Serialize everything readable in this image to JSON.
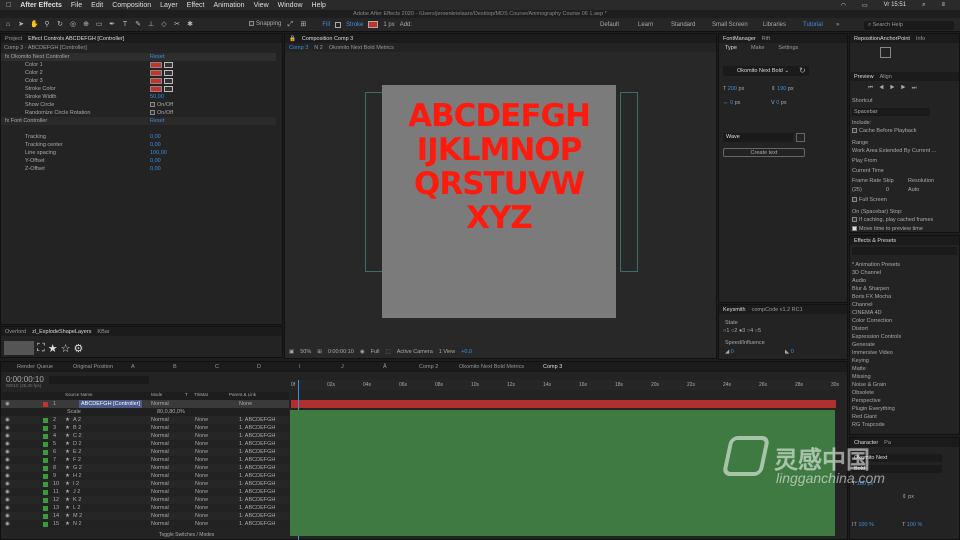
{
  "mac": {
    "apple": "",
    "app": "After Effects",
    "menus": [
      "File",
      "Edit",
      "Composition",
      "Layer",
      "Effect",
      "Animation",
      "View",
      "Window",
      "Help"
    ],
    "clock": "Vr 15:51"
  },
  "window_title": "Adobe After Effects 2020 - /Users/jeroenkrielaars/Desktop/MDS Course/Animography Course 06 1.aep *",
  "toolbar": {
    "snapping": "Snapping",
    "fill": "Fill",
    "stroke": "Stroke",
    "px": "1 px",
    "add": "Add:",
    "workspaces": [
      "Default",
      "Learn",
      "Standard",
      "Small Screen",
      "Libraries",
      "Tutorial"
    ],
    "search": "Search Help"
  },
  "effect_panel": {
    "tabs": [
      "Project",
      "Effect Controls ABCDEFGH [Controller]"
    ],
    "header": "Comp 3 · ABCDEFGH [Controller]",
    "rows": [
      {
        "label": "fx  Okomito Next Controller",
        "value": "Reset"
      },
      {
        "label": "Color 1"
      },
      {
        "label": "Color 2"
      },
      {
        "label": "Color 3"
      },
      {
        "label": "Stroke Color"
      },
      {
        "label": "Stroke Width",
        "value": "50,00"
      },
      {
        "label": "Show Circle",
        "value": "On/Off"
      },
      {
        "label": "Randomize Circle Rotation",
        "value": "On/Off"
      },
      {
        "label": "fx  Font Controller",
        "value": "Reset"
      },
      {
        "label": "Tracking",
        "value": "0,00"
      },
      {
        "label": "Tracking center",
        "value": "0,00"
      },
      {
        "label": "Line spacing",
        "value": "100,00"
      },
      {
        "label": "Y-Offset",
        "value": "0,00"
      },
      {
        "label": "Z-Offset",
        "value": "0,00"
      }
    ]
  },
  "overlord": {
    "tabs": [
      "Overlord",
      "zl_ExplodeShapeLayers",
      "KBar"
    ]
  },
  "comp_panel": {
    "tab": "Composition Comp 3",
    "sub_tabs": [
      "Comp 3",
      "N 2",
      "Okomito Next Bold Metrics"
    ],
    "letters": [
      "ABCDEFGH",
      "IJKLMNOP",
      "QRSTUVW",
      "XYZ"
    ],
    "footer": {
      "zoom": "50%",
      "time": "0:00:00:10",
      "res": "Full",
      "camera": "Active Camera",
      "view": "1 View",
      "offset": "+0,0"
    }
  },
  "font_manager": {
    "tabs": [
      "FontManager",
      "Rift"
    ],
    "subtabs": [
      "Type",
      "Make",
      "Settings"
    ],
    "font": "Okomito Next Bold",
    "size": "200",
    "size_unit": "px",
    "leading": "190",
    "leading_unit": "px",
    "tracking": "0",
    "tracking_unit": "px",
    "kern": "0",
    "kern_unit": "px",
    "wave": "Wave",
    "create": "Create text"
  },
  "keysmith": {
    "tabs": [
      "Keysmith",
      "compCode v1.2 RC1"
    ],
    "state": "State",
    "options": [
      "1",
      "2",
      "3",
      "4",
      "5"
    ],
    "speed": "Speed/Influence",
    "speed_val": "0",
    "infl_val": "0"
  },
  "preview": {
    "top_tabs": [
      "RepositionAnchorPoint",
      "Info"
    ],
    "tabs": [
      "Preview",
      "Align"
    ],
    "shortcut_label": "Shortcut",
    "shortcut": "Spacebar",
    "include": "Include:",
    "cache": "Cache Before Playback",
    "range_label": "Range",
    "range": "Work Area Extended By Current ...",
    "play_from_label": "Play From",
    "play_from": "Current Time",
    "fr_label": "Frame Rate",
    "skip_label": "Skip",
    "res_label": "Resolution",
    "fr": "(25)",
    "skip": "0",
    "res": "Auto",
    "full_screen": "Full Screen",
    "stop_label": "On (Spacebar) Stop:",
    "if_caching": "If caching, play cached frames",
    "move_time": "Move time to preview time"
  },
  "effects": {
    "title": "Effects & Presets",
    "search": "",
    "items": [
      "* Animation Presets",
      "3D Channel",
      "Audio",
      "Blur & Sharpen",
      "Boris FX Mocha",
      "Channel",
      "CINEMA 4D",
      "Color Correction",
      "Distort",
      "Expression Controls",
      "Generate",
      "Immersive Video",
      "Keying",
      "Matte",
      "Missing",
      "Noise & Grain",
      "Obsolete",
      "Perspective",
      "Plugin Everything",
      "Red Giant",
      "RG Trapcode"
    ]
  },
  "character": {
    "tabs": [
      "Character",
      "Pa"
    ],
    "font": "Okomito Next",
    "style": "Bold",
    "size": "180 px",
    "leading": "px",
    "scale_v": "100 %",
    "scale_h": "100 %"
  },
  "timeline": {
    "tabs": [
      "Render Queue",
      "Original Position",
      "A",
      "B",
      "C",
      "D",
      "I",
      "J",
      "Å",
      "Comp 2",
      "Okomito Next Bold Metrics",
      "Comp 3"
    ],
    "time": "0:00:00:10",
    "fps": "00010 (25,00 fps)",
    "cols": [
      "Source Name",
      "Mode",
      "T",
      "TrkMat",
      "Parent & Link"
    ],
    "controller": {
      "num": "1",
      "name": "ABCDEFGH [Controller]",
      "mode": "Normal",
      "parent": "None"
    },
    "scale": {
      "label": "Scale",
      "value": "80,0,80,0%"
    },
    "layers": [
      {
        "num": "2",
        "name": "A 2"
      },
      {
        "num": "3",
        "name": "B 2"
      },
      {
        "num": "4",
        "name": "C 2"
      },
      {
        "num": "5",
        "name": "D 2"
      },
      {
        "num": "6",
        "name": "E 2"
      },
      {
        "num": "7",
        "name": "F 2"
      },
      {
        "num": "8",
        "name": "G 2"
      },
      {
        "num": "9",
        "name": "H 2"
      },
      {
        "num": "10",
        "name": "I 2"
      },
      {
        "num": "11",
        "name": "J 2"
      },
      {
        "num": "12",
        "name": "K 2"
      },
      {
        "num": "13",
        "name": "L 2"
      },
      {
        "num": "14",
        "name": "M 2"
      },
      {
        "num": "15",
        "name": "N 2"
      }
    ],
    "mode": "Normal",
    "trk": "None",
    "parent": "1. ABCDEFGH",
    "ruler": [
      "0f",
      "02s",
      "04s",
      "06s",
      "08s",
      "10s",
      "12s",
      "14s",
      "16s",
      "18s",
      "20s",
      "22s",
      "24s",
      "26s",
      "28s",
      "30s"
    ],
    "toggle": "Toggle Switches / Modes"
  },
  "watermark": {
    "text": "灵感中国",
    "url": "lingganchina.com"
  }
}
